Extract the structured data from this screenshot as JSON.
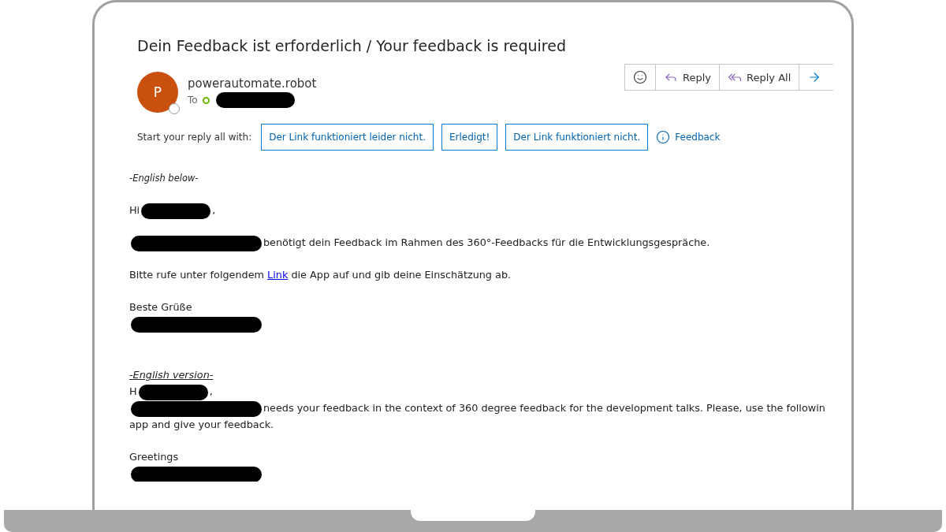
{
  "email": {
    "subject": "Dein Feedback ist erforderlich / Your feedback is required",
    "sender": {
      "initial": "P",
      "name": "powerautomate.robot",
      "to_label": "To"
    },
    "actions": [
      {
        "kind": "emoji"
      },
      {
        "kind": "reply",
        "label": "Reply"
      },
      {
        "kind": "reply_all",
        "label": "Reply All"
      },
      {
        "kind": "forward"
      }
    ],
    "quick_replies": {
      "label": "Start your reply all with:",
      "options": [
        "Der Link funktioniert leider nicht.",
        "Erledigt!",
        "Der Link funktioniert nicht."
      ],
      "feedback": "Feedback"
    },
    "body": [
      {
        "kind": "note",
        "lines": [
          [
            {
              "kind": "italic",
              "text": "-English below-"
            }
          ]
        ]
      },
      {
        "kind": "normal",
        "lines": [
          [
            {
              "kind": "text",
              "text": "Hi"
            },
            {
              "kind": "redacted-short"
            },
            {
              "kind": "text",
              "text": ","
            }
          ]
        ]
      },
      {
        "kind": "normal",
        "lines": [
          [
            {
              "kind": "redacted-long"
            },
            {
              "kind": "text",
              "text": "benötigt dein Feedback im Rahmen des 360°-Feedbacks für die Entwicklungsgespräche."
            }
          ]
        ]
      },
      {
        "kind": "normal",
        "lines": [
          [
            {
              "kind": "text",
              "text": "Bitte rufe unter folgendem "
            },
            {
              "kind": "link",
              "text": "Link"
            },
            {
              "kind": "text",
              "text": " die App auf und gib deine Einschätzung ab."
            }
          ]
        ]
      },
      {
        "kind": "normal",
        "lines": [
          [
            {
              "kind": "text",
              "text": "Beste Grüße"
            }
          ],
          [
            {
              "kind": "redacted-long"
            }
          ]
        ]
      },
      {
        "kind": "section",
        "lines": [
          [
            {
              "kind": "italic-underlined",
              "text": "-English version-"
            }
          ],
          [
            {
              "kind": "text",
              "text": "H"
            },
            {
              "kind": "redacted-short"
            },
            {
              "kind": "text",
              "text": ","
            }
          ],
          [
            {
              "kind": "redacted-long"
            },
            {
              "kind": "text",
              "text": "needs your feedback in the context of 360 degree feedback for the development talks. Please, use the followin"
            }
          ],
          [
            {
              "kind": "text",
              "text": "app and give your feedback."
            }
          ]
        ]
      },
      {
        "kind": "normal",
        "lines": [
          [
            {
              "kind": "text",
              "text": "Greetings"
            }
          ],
          [
            {
              "kind": "redacted-long"
            }
          ]
        ]
      }
    ]
  }
}
